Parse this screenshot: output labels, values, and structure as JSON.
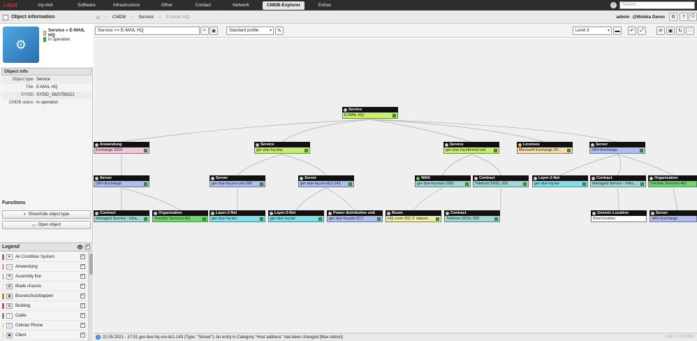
{
  "nav": {
    "logo": "i-doit",
    "items": [
      "my-doit",
      "Software",
      "Infrastructure",
      "Other",
      "Contact",
      "Network",
      "CMDB-Explorer",
      "Extras"
    ],
    "search_placeholder": "Search..."
  },
  "breadcrumb": {
    "panel_title": "Object information",
    "items": [
      "CMDB",
      "Service",
      "E-MAIL HQ"
    ],
    "user": "admin",
    "tenant": "@Mokka Demo"
  },
  "object": {
    "title": "Service » E-MAIL HQ",
    "status": "in operation",
    "info_header": "Object info",
    "info": [
      {
        "label": "Object type",
        "value": "Service"
      },
      {
        "label": "Title",
        "value": "E-MAIL HQ"
      },
      {
        "label": "SYSID",
        "value": "SYSID_1620756221"
      },
      {
        "label": "CMDB status",
        "value": "in operation"
      }
    ]
  },
  "functions": {
    "title": "Functions",
    "buttons": [
      "Show/hide object type",
      "Open object"
    ]
  },
  "legend": {
    "title": "Legend",
    "items": [
      {
        "label": "Air Condition System",
        "color": "#9b6b6b"
      },
      {
        "label": "Anwendung",
        "color": "#e5a0c8"
      },
      {
        "label": "Assembly line",
        "color": "#b9c7e8"
      },
      {
        "label": "Blade chassis",
        "color": "#ffffff"
      },
      {
        "label": "Brandschutzklappen",
        "color": "#e57a2c"
      },
      {
        "label": "Building",
        "color": "#c45050"
      },
      {
        "label": "Cable",
        "color": "#888888"
      },
      {
        "label": "Cellular Phone",
        "color": "#e8e8a0"
      },
      {
        "label": "Client",
        "color": "#e0e0e0"
      }
    ]
  },
  "toolbar": {
    "object_field": "Service >> E-MAIL HQ",
    "profile": "Standard profile",
    "level": "Level 3"
  },
  "graph": {
    "root": {
      "type": "Service",
      "title": "E-MAIL HQ",
      "color": "#c6ef6e"
    },
    "level1": [
      {
        "type": "Anwendung",
        "title": "Exchange 2019",
        "color": "#f2c6dd"
      },
      {
        "type": "Service",
        "title": "ger-due-hq-dns",
        "color": "#c6ef6e"
      },
      {
        "type": "Service",
        "title": "ger-due-hq-internet-vsd",
        "color": "#c6ef6e"
      },
      {
        "type": "Licenses",
        "title": "Microsoft Exchange 20...",
        "color": "#f5deaf"
      },
      {
        "type": "Server",
        "title": "SRV-Exchange",
        "color": "#aebef0"
      }
    ],
    "level2": [
      {
        "type": "Server",
        "title": "SRV-Exchange",
        "color": "#aebef0"
      },
      {
        "type": "Server",
        "title": "ger-due-hq-srv-crm-200",
        "color": "#aebef0"
      },
      {
        "type": "Server",
        "title": "ger-due-hq-srv-dc1-143",
        "color": "#aebef0"
      },
      {
        "type": "WAN",
        "title": "ger-due-hq-wan-1591",
        "color": "#9fd6d6"
      },
      {
        "type": "Contract",
        "title": "Telekom SDSL 200",
        "color": "#9fd6d6"
      },
      {
        "type": "Layer-2-Net",
        "title": "ger-due-hq-lan",
        "color": "#7fe0ec"
      },
      {
        "type": "Contract",
        "title": "Managed Service - Infra...",
        "color": "#9fd6d6"
      },
      {
        "type": "Organization",
        "title": "Treckler Services AG",
        "color": "#6fd66f"
      }
    ],
    "level3": [
      {
        "type": "Contract",
        "title": "Managed Service - Infra...",
        "color": "#9fd6d6"
      },
      {
        "type": "Organization",
        "title": "Treckler Services AG",
        "color": "#6fd66f"
      },
      {
        "type": "Layer-2-Net",
        "title": "ger-due-hq-lan",
        "color": "#7fe0ec"
      },
      {
        "type": "Layer-2-Net",
        "title": "ger-due-hq-lan",
        "color": "#7fe0ec"
      },
      {
        "type": "Power distribution unit",
        "title": "ger-due-hq-pdu-517",
        "color": "#aebef0"
      },
      {
        "type": "Room",
        "title": "HQ room 002 IT datace...",
        "color": "#eef0a8"
      },
      {
        "type": "Contract",
        "title": "Telekom SDSL 200",
        "color": "#9fd6d6"
      },
      {
        "type": "Generic Location",
        "title": "Root location",
        "color": "#ffffff"
      },
      {
        "type": "Server",
        "title": "SRV-Exchange",
        "color": "#aebef0"
      }
    ]
  },
  "status": {
    "message": "22.05.2021 - 17:51 ger-due-hq-srv-dc1-143 (Type: \"Server\"): An entry in Category \"Host address\" has been changed [Max Admin]",
    "version": "i-doit 1.16.2 PRO"
  }
}
